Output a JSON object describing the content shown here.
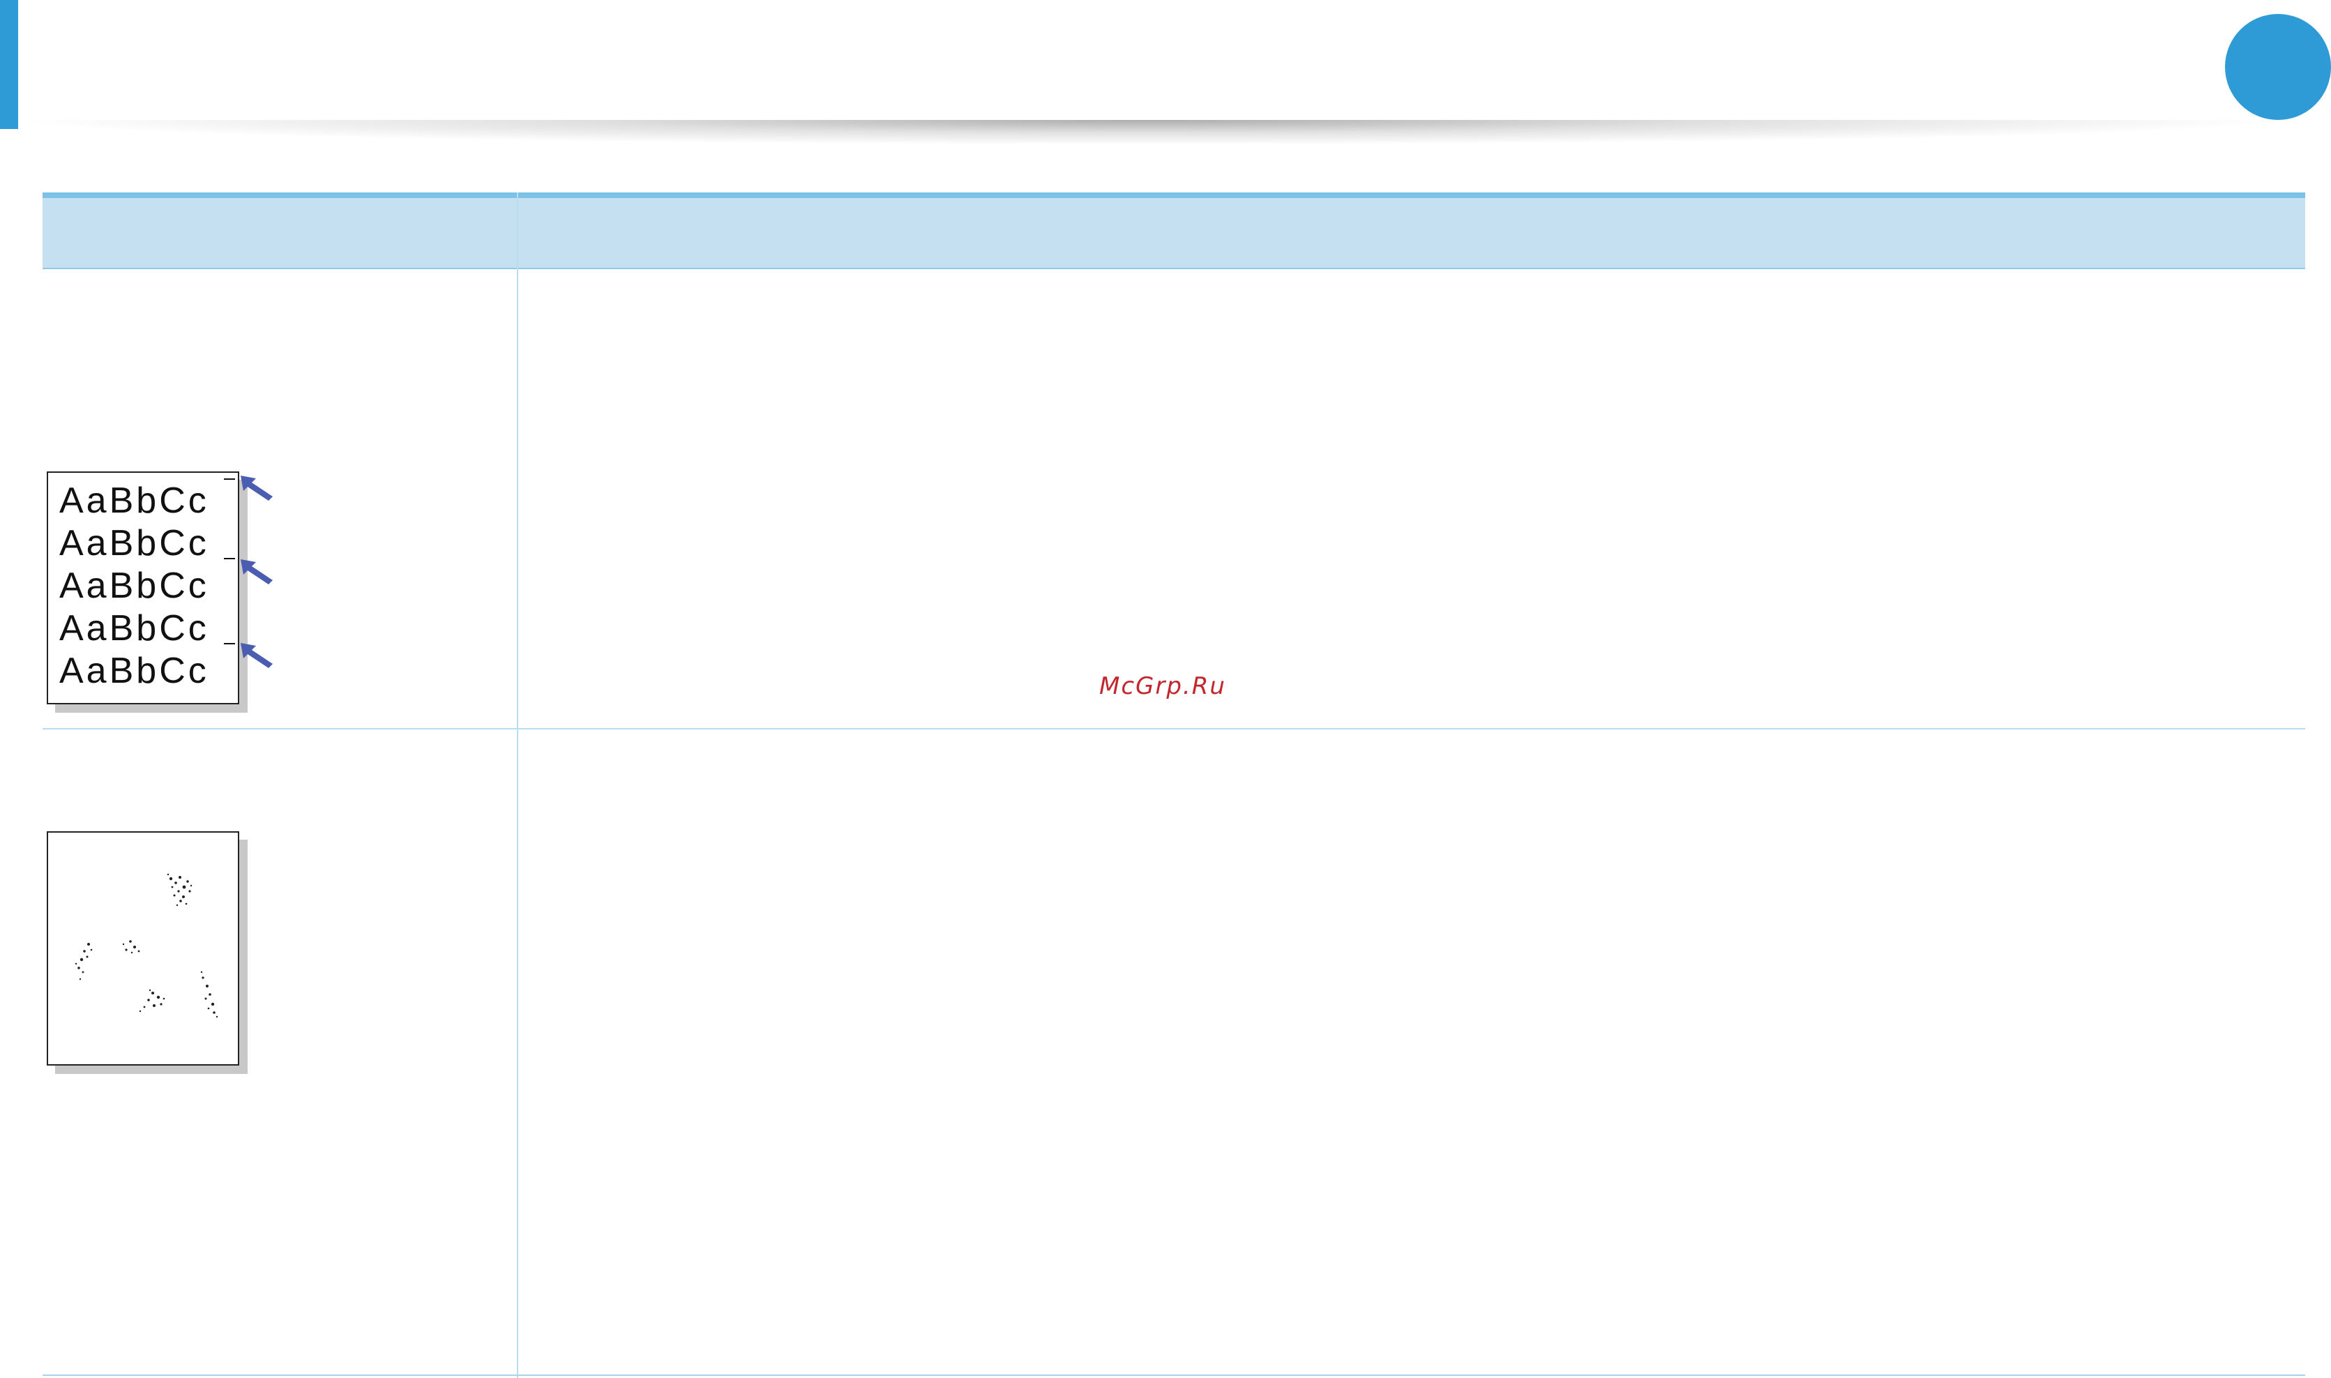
{
  "header": {
    "accent_color": "#2f9bd6",
    "page_number": ""
  },
  "table": {
    "header_color": "#c5e1f1",
    "header_border_color": "#7cc1e6",
    "columns": [
      "",
      ""
    ],
    "rows": [
      {
        "sample": {
          "type": "text-with-marks",
          "lines": [
            "AaBbCc",
            "AaBbCc",
            "AaBbCc",
            "AaBbCc",
            "AaBbCc"
          ],
          "arrow_color": "#4a5db0"
        },
        "description": ""
      },
      {
        "sample": {
          "type": "scattered-spots"
        },
        "description": ""
      }
    ]
  },
  "watermark": {
    "text": "McGrp.Ru",
    "color": "#c1272d"
  }
}
